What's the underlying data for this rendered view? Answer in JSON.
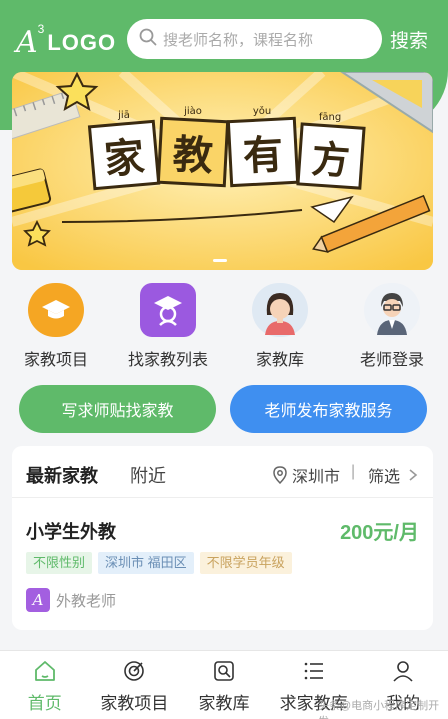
{
  "header": {
    "logo_mark": "A",
    "logo_sup": "3",
    "logo_text": "LOGO",
    "search_placeholder": "搜老师名称，课程名称",
    "search_button": "搜索"
  },
  "banner": {
    "title_chars": [
      "家",
      "教",
      "有",
      "方"
    ],
    "pinyin": [
      "jiā",
      "jiào",
      "yǒu",
      "fāng"
    ]
  },
  "quick_links": [
    {
      "label": "家教项目",
      "icon": "graduation-cap-icon",
      "color": "#f5a623"
    },
    {
      "label": "找家教列表",
      "icon": "student-cap-icon",
      "color": "#9b59e0"
    },
    {
      "label": "家教库",
      "icon": "female-teacher-avatar-icon",
      "color": "#e3ecf5"
    },
    {
      "label": "老师登录",
      "icon": "male-teacher-avatar-icon",
      "color": "#eef2f7"
    }
  ],
  "actions": {
    "left": "写求师贴找家教",
    "right": "老师发布家教服务"
  },
  "listing": {
    "tab_active": "最新家教",
    "tab_other": "附近",
    "location": "深圳市",
    "separator": "|",
    "filter": "筛选",
    "job": {
      "title": "小学生外教",
      "price": "200元/月",
      "tags": [
        "不限性别",
        "深圳市 福田区",
        "不限学员年级"
      ],
      "teacher_type": "外教老师",
      "teacher_icon_letter": "A"
    }
  },
  "tabbar": [
    {
      "label": "首页",
      "icon": "home-icon",
      "active": true
    },
    {
      "label": "家教项目",
      "icon": "target-icon",
      "active": false
    },
    {
      "label": "家教库",
      "icon": "search-library-icon",
      "active": false
    },
    {
      "label": "求家教库",
      "icon": "list-icon",
      "active": false
    },
    {
      "label": "我的",
      "icon": "user-icon",
      "active": false
    }
  ],
  "watermark": "头条@电商小程序定制开发",
  "colors": {
    "brand_green": "#5fba6a",
    "brand_blue": "#3f8ff0"
  }
}
